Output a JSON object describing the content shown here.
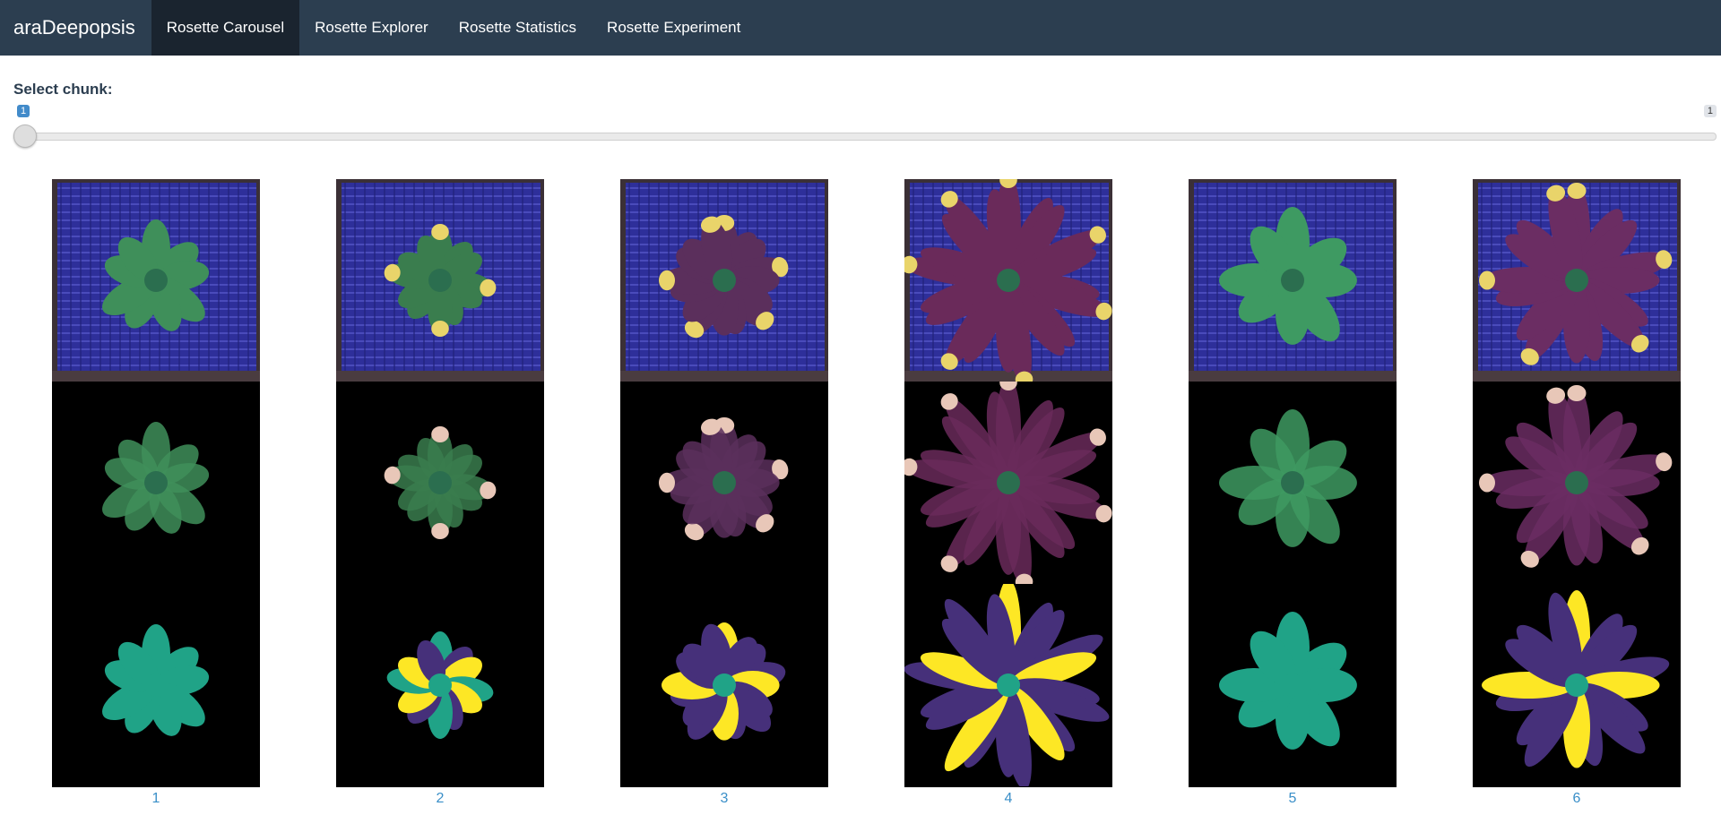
{
  "nav": {
    "brand": "araDeepopsis",
    "tabs": [
      {
        "label": "Rosette Carousel",
        "active": true
      },
      {
        "label": "Rosette Explorer",
        "active": false
      },
      {
        "label": "Rosette Statistics",
        "active": false
      },
      {
        "label": "Rosette Experiment",
        "active": false
      }
    ]
  },
  "chunk": {
    "label": "Select chunk:",
    "min": "1",
    "max": "1",
    "value": "1"
  },
  "carousel": {
    "items": [
      {
        "label": "1",
        "plant": "green-small",
        "photo_leaf_color": "#3f8f5a",
        "mask_leaf_color": "#20a387"
      },
      {
        "label": "2",
        "plant": "mixed-yellow",
        "photo_leaf_color": "#3a7d4e",
        "mask_leaf_color": "#fde725"
      },
      {
        "label": "3",
        "plant": "purple-dense",
        "photo_leaf_color": "#5b2f5c",
        "mask_leaf_color": "#440f5c"
      },
      {
        "label": "4",
        "plant": "purple-large",
        "photo_leaf_color": "#6a2a5a",
        "mask_leaf_color": "#44296f"
      },
      {
        "label": "5",
        "plant": "green-medium",
        "photo_leaf_color": "#3e9a62",
        "mask_leaf_color": "#20a387"
      },
      {
        "label": "6",
        "plant": "purple-medium",
        "photo_leaf_color": "#6b2d63",
        "mask_leaf_color": "#45307b"
      }
    ],
    "colors": {
      "tray_blue": "#2e2f9a",
      "mask_purple": "#46307a",
      "mask_teal": "#20a387",
      "mask_yellow": "#fde725"
    }
  }
}
